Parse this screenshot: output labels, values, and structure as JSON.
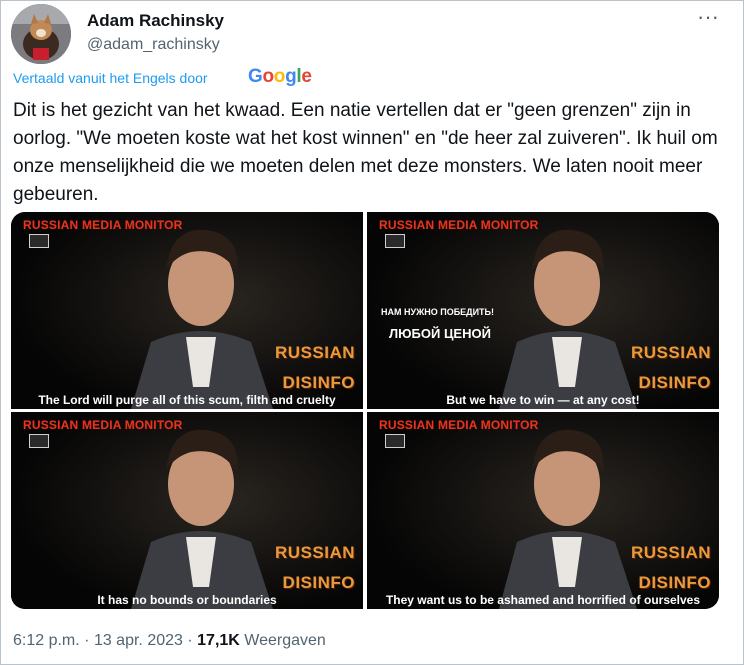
{
  "author": {
    "name": "Adam Rachinsky",
    "handle": "@adam_rachinsky"
  },
  "translation": {
    "label": "Vertaald vanuit het Engels door",
    "provider": [
      "G",
      "o",
      "o",
      "g",
      "l",
      "e"
    ]
  },
  "tweet_text": "Dit is het gezicht van het kwaad. Een natie vertellen dat er \"geen grenzen\" zijn in oorlog. \"We moeten koste wat het kost winnen\" en \"de heer zal zuiveren\". Ik huil om onze menselijkheid die we moeten delen met deze monsters. We laten nooit meer gebeuren.",
  "media": {
    "tiles": [
      {
        "header": "RUSSIAN MEDIA MONITOR",
        "watermark_line1": "RUSSIAN",
        "watermark_line2": "DISINFO",
        "caption": "The Lord will purge all of this scum, filth and cruelty"
      },
      {
        "header": "RUSSIAN MEDIA MONITOR",
        "watermark_line1": "RUSSIAN",
        "watermark_line2": "DISINFO",
        "caption": "But we have to win — at any cost!",
        "overlay_small": "НАМ НУЖНО ПОБЕДИТЬ!",
        "overlay_big": "ЛЮБОЙ ЦЕНОЙ"
      },
      {
        "header": "RUSSIAN MEDIA MONITOR",
        "watermark_line1": "RUSSIAN",
        "watermark_line2": "DISINFO",
        "caption": "It has no bounds or boundaries"
      },
      {
        "header": "RUSSIAN MEDIA MONITOR",
        "watermark_line1": "RUSSIAN",
        "watermark_line2": "DISINFO",
        "caption": "They want us to be ashamed and horrified of ourselves"
      }
    ]
  },
  "footer": {
    "time": "6:12 p.m.",
    "separator": "·",
    "date": "13 apr. 2023",
    "views_count": "17,1K",
    "views_label": "Weergaven"
  },
  "icons": {
    "more": "more-options-icon",
    "monitor": "monitor-logo-icon"
  },
  "colors": {
    "link": "#1d9bf0",
    "secondary_text": "#536471",
    "primary_text": "#0f1419",
    "header_red": "#e0371e",
    "watermark_orange": "#e89a3c"
  }
}
